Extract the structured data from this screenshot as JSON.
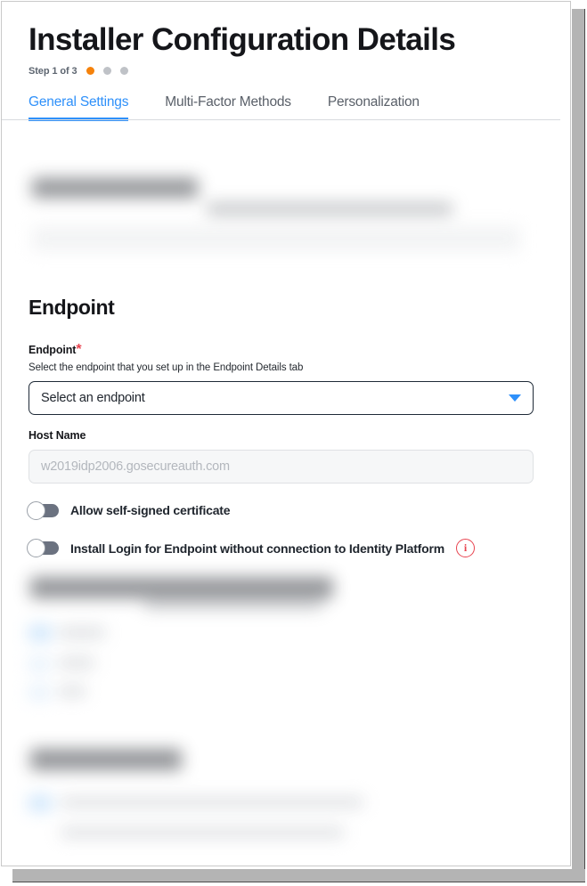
{
  "window": {
    "scrollbar": "vertical-scrollbar"
  },
  "header": {
    "title": "Installer Configuration Details",
    "step_label": "Step 1 of 3",
    "step_current": 1,
    "step_total": 3,
    "active_dot_color": "#f5820b",
    "inactive_dot_color": "#bfc2c7"
  },
  "tabs": [
    {
      "label": "General Settings",
      "active": true
    },
    {
      "label": "Multi-Factor Methods",
      "active": false
    },
    {
      "label": "Personalization",
      "active": false
    }
  ],
  "redacted_top": {
    "note": "blurred section"
  },
  "endpoint_section": {
    "heading": "Endpoint",
    "endpoint_field": {
      "label": "Endpoint",
      "required_marker": "*",
      "help_text": "Select the endpoint that you set up in the Endpoint Details tab",
      "selected_value": "Select an endpoint",
      "caret": "chevron-down-icon"
    },
    "host_name_field": {
      "label": "Host Name",
      "value": "w2019idp2006.gosecureauth.com",
      "disabled": true
    },
    "toggles": [
      {
        "label": "Allow self-signed certificate",
        "state": "off",
        "has_info": false
      },
      {
        "label": "Install Login for Endpoint without connection to Identity Platform",
        "state": "off",
        "has_info": true,
        "info_icon": "info-circle-icon",
        "info_color": "#e8434f"
      }
    ]
  },
  "redacted_middle": {
    "note": "blurred section"
  },
  "redacted_bottom": {
    "note": "blurred section"
  },
  "colors": {
    "accent_blue": "#2e90fa",
    "step_orange": "#f5820b",
    "required_red": "#e8434f",
    "text_dark": "#15161a",
    "text_muted": "#5a6069"
  }
}
